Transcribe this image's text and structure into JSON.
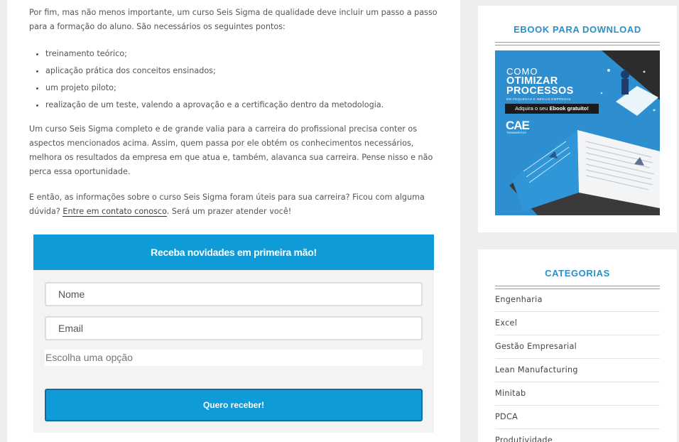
{
  "article": {
    "intro": "Por fim, mas não menos importante, um curso Seis Sigma de qualidade deve incluir um passo a passo para a formação do aluno. São necessários os seguintes pontos:",
    "list": [
      "treinamento teórico;",
      "aplicação prática dos conceitos ensinados;",
      "um projeto piloto;",
      "realização de um teste, valendo a aprovação e a certificação dentro da metodologia."
    ],
    "paragraph2": "Um curso Seis Sigma completo e de grande valia para a carreira do profissional precisa conter os aspectos mencionados acima. Assim, quem passa por ele obtém os conhecimentos necessários, melhora os resultados da empresa em que atua e, também, alavanca sua carreira. Pense nisso e não perca essa oportunidade.",
    "paragraph3_before": "E então, as informações sobre o curso Seis Sigma foram úteis para sua carreira? Ficou com alguma dúvida? ",
    "paragraph3_link": "Entre em contato conosco",
    "paragraph3_after": ". Será um prazer atender você!"
  },
  "newsletter": {
    "header": "Receba novidades em primeira mão!",
    "name_placeholder": "Nome",
    "email_placeholder": "Email",
    "select_value": "Escolha uma opção",
    "button_label": "Quero receber!"
  },
  "sidebar": {
    "ebook": {
      "title": "EBOOK PARA DOWNLOAD",
      "banner": {
        "line1": "COMO",
        "line2": "OTIMIZAR",
        "line3": "PROCESSOS",
        "subtitle": "EM PEQUENAS E MÉDIAS EMPRESAS",
        "cta_prefix": "Adquira o seu ",
        "cta_bold": "Ebook gratuito!",
        "logo": "CAE",
        "logo_sub": "TREINAMENTOS"
      }
    },
    "categories": {
      "title": "CATEGORIAS",
      "items": [
        "Engenharia",
        "Excel",
        "Gestão Empresarial",
        "Lean Manufacturing",
        "Minitab",
        "PDCA",
        "Produtividade"
      ]
    }
  },
  "colors": {
    "accent": "#0f9bd7",
    "widget_title": "#2a8fc9",
    "banner_blue": "#2e8fd0"
  }
}
